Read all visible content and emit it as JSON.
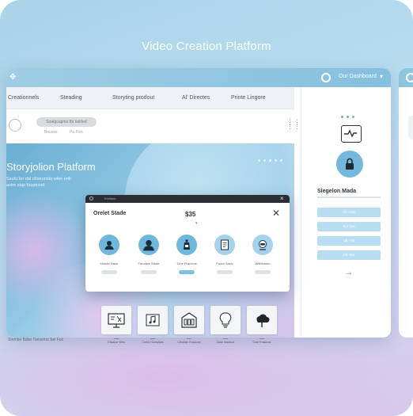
{
  "page": {
    "title": "Video Creation Platform"
  },
  "window": {
    "account_label": "Our Dashboard",
    "nav": [
      "Creationnels",
      "Steading",
      "Storyting prodout",
      "Al' Directes",
      "Printe Lingore"
    ],
    "profile": {
      "pill_label": "Soatgcapmo thr tielrled",
      "sub1": "Bousse",
      "sub2": "Pa Fics"
    },
    "hero": {
      "title": "Storyjolion Platform",
      "subtitle_line1": "Sautu ter dal obseunsto wtee enb",
      "subtitle_line2": "astre stap foupezod",
      "footer": "Stombe Bdse Toesemo Sel Fok"
    }
  },
  "modal": {
    "bar_label": "Emllane",
    "title": "Orelet Stade",
    "price": "$35",
    "avatars": [
      {
        "icon": "person-icon",
        "label": "Motcbr Nane",
        "active": false
      },
      {
        "icon": "person-icon",
        "label": "Fanotwe Stude",
        "active": false
      },
      {
        "icon": "bottle-icon",
        "label": "Tone Practone",
        "active": true
      },
      {
        "icon": "document-icon",
        "label": "Fonor Sasic",
        "active": false
      },
      {
        "icon": "robot-icon",
        "label": "Withtomeo",
        "active": false
      }
    ]
  },
  "side_panel": {
    "heading": "Slegelon Mada",
    "buttons": [
      "Ub Vots",
      "Eol Vos",
      "Ub Vos",
      "Ub Vos"
    ]
  },
  "thumbnails": [
    {
      "icon": "presentation-icon",
      "label": "Eticarve Wea"
    },
    {
      "icon": "music-icon",
      "label": "Crefor Hnesviiles"
    },
    {
      "icon": "building-icon",
      "label": "Clerebie Goaoune"
    },
    {
      "icon": "lightbulb-icon",
      "label": "Ostle Mawcue"
    },
    {
      "icon": "cloud-icon",
      "label": "Cere Entstone"
    }
  ],
  "colors": {
    "accent": "#74b8dd",
    "bar": "#8fc6e0",
    "modal_bar": "#2b2f33"
  }
}
